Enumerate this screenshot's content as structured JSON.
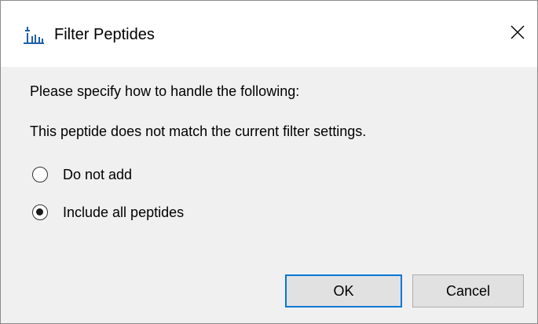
{
  "window": {
    "title": "Filter Peptides",
    "app_icon": "skyline-icon",
    "close_icon": "close-icon"
  },
  "dialog": {
    "prompt": "Please specify how to handle the following:",
    "message": "This peptide does not match the current filter settings.",
    "options": [
      {
        "label": "Do not add",
        "selected": false
      },
      {
        "label": "Include all peptides",
        "selected": true
      }
    ],
    "ok_label": "OK",
    "cancel_label": "Cancel"
  },
  "colors": {
    "dialog_background": "#f0f0f0",
    "titlebar_background": "#ffffff",
    "default_button_border": "#0078d7",
    "app_icon_color": "#1f5fa8"
  }
}
